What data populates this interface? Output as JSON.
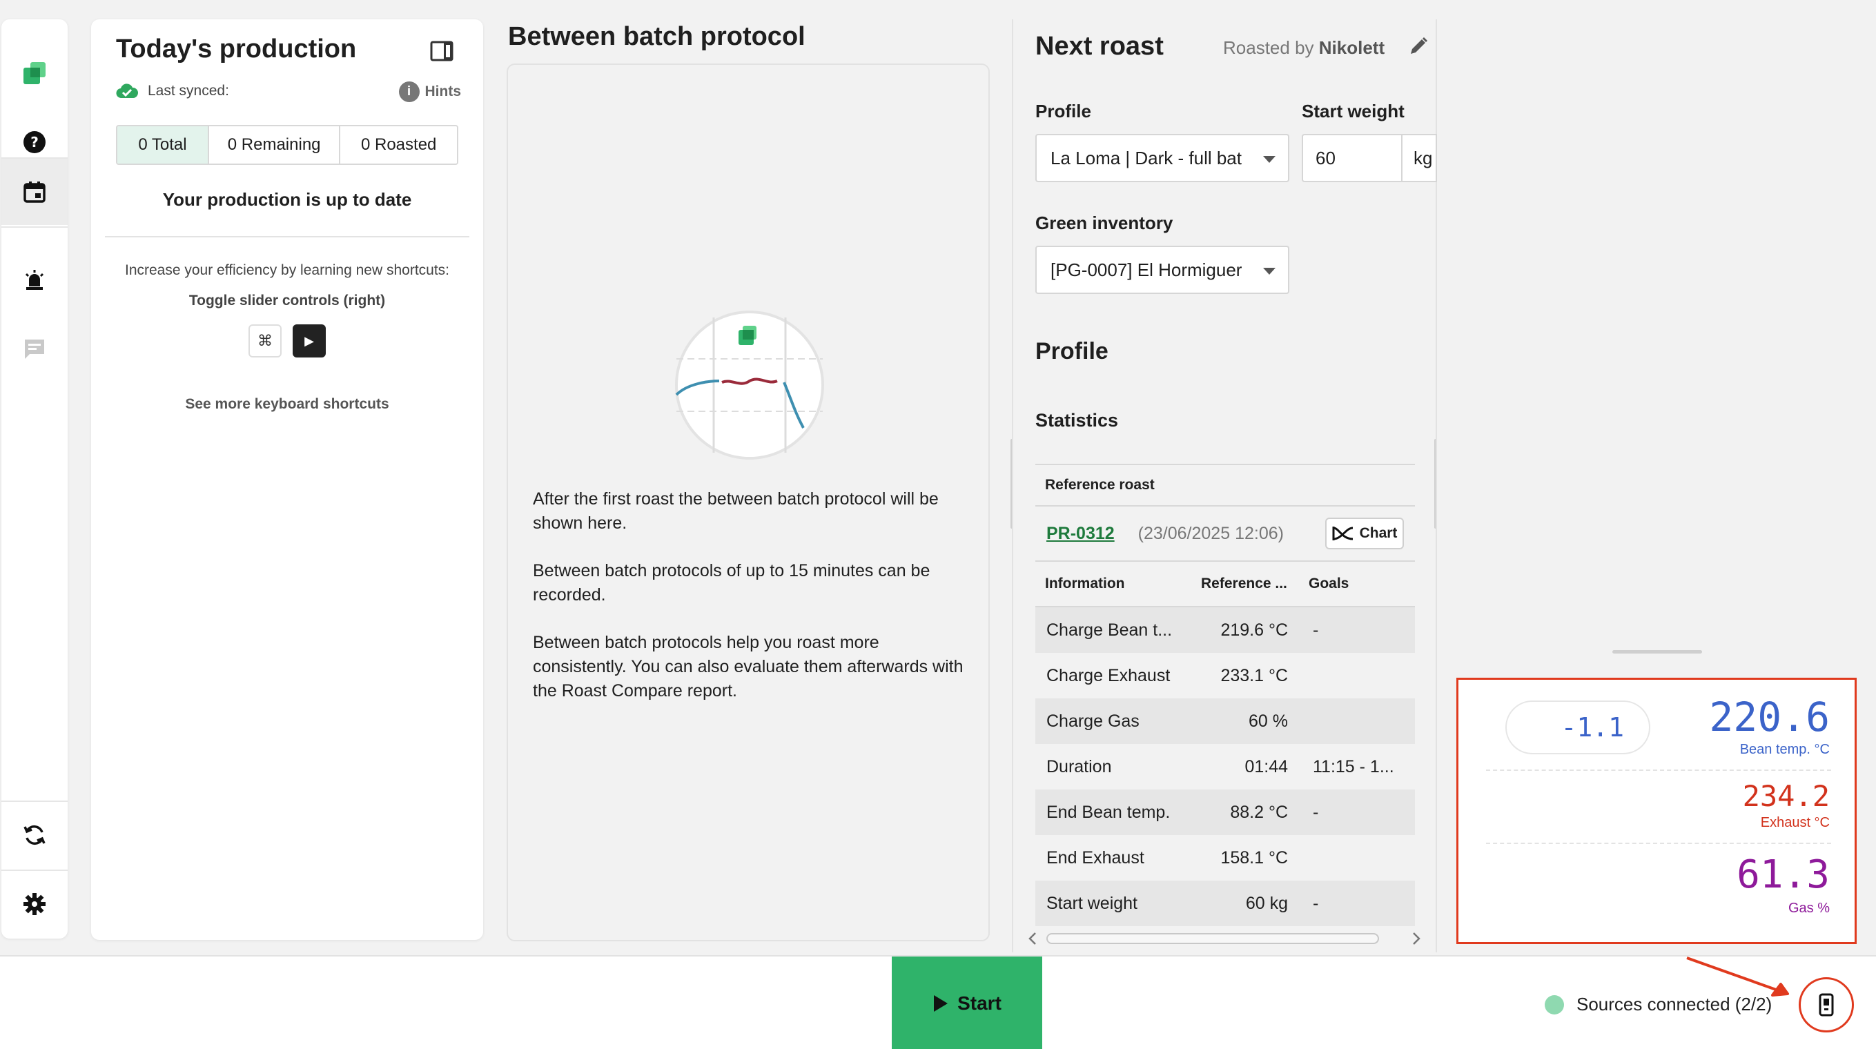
{
  "rail": {
    "icons": [
      "app-logo-icon",
      "help-icon",
      "calendar-icon",
      "alarm-icon",
      "chat-icon",
      "sync-icon",
      "gear-icon"
    ]
  },
  "production": {
    "title": "Today's production",
    "last_synced_label": "Last synced:",
    "hints_label": "Hints",
    "tabs": [
      {
        "label": "0 Total",
        "active": true
      },
      {
        "label": "0 Remaining",
        "active": false
      },
      {
        "label": "0 Roasted",
        "active": false
      }
    ],
    "status": "Your production is up to date",
    "efficiency_text": "Increase your efficiency by learning new shortcuts:",
    "shortcut_name": "Toggle slider controls (right)",
    "key_1": "⌘",
    "key_2": "▶",
    "more_shortcuts": "See more keyboard shortcuts"
  },
  "bbp": {
    "title": "Between batch protocol",
    "p1": "After the first roast the between batch protocol will be shown here.",
    "p2": "Between batch protocols of up to 15 minutes can be recorded.",
    "p3": "Between batch protocols help you roast more consistently. You can also evaluate them afterwards with the Roast Compare report."
  },
  "next_roast": {
    "title": "Next roast",
    "roasted_by_prefix": "Roasted by",
    "roaster": "Nikolett",
    "profile_label": "Profile",
    "profile_value": "La Loma | Dark - full bat",
    "start_weight_label": "Start weight",
    "start_weight_value": "60",
    "start_weight_unit": "kg",
    "green_inventory_label": "Green inventory",
    "green_inventory_value": "[PG-0007] El Hormiguer",
    "profile_heading": "Profile",
    "statistics_heading": "Statistics",
    "reference_roast_label": "Reference roast",
    "reference_id": "PR-0312",
    "reference_date": "(23/06/2025 12:06)",
    "chart_button": "Chart",
    "columns": [
      "Information",
      "Reference ...",
      "Goals"
    ],
    "rows": [
      {
        "info": "Charge Bean t...",
        "ref": "219.6 °C",
        "goal": "-"
      },
      {
        "info": "Charge Exhaust",
        "ref": "233.1 °C",
        "goal": ""
      },
      {
        "info": "Charge Gas",
        "ref": "60 %",
        "goal": ""
      },
      {
        "info": "Duration",
        "ref": "01:44",
        "goal": "11:15 - 1..."
      },
      {
        "info": "End Bean temp.",
        "ref": "88.2 °C",
        "goal": "-"
      },
      {
        "info": "End Exhaust",
        "ref": "158.1 °C",
        "goal": ""
      },
      {
        "info": "Start weight",
        "ref": "60 kg",
        "goal": "-"
      }
    ]
  },
  "readouts": {
    "delta": "-1.1",
    "bean_value": "220.6",
    "bean_label": "Bean temp. °C",
    "exhaust_value": "234.2",
    "exhaust_label": "Exhaust °C",
    "gas_value": "61.3",
    "gas_label": "Gas %",
    "colors": {
      "bean": "#3b63c9",
      "exhaust": "#d2321c",
      "gas": "#8e1a9a"
    }
  },
  "bottom": {
    "start_label": "Start",
    "sources_label": "Sources connected (2/2)"
  }
}
